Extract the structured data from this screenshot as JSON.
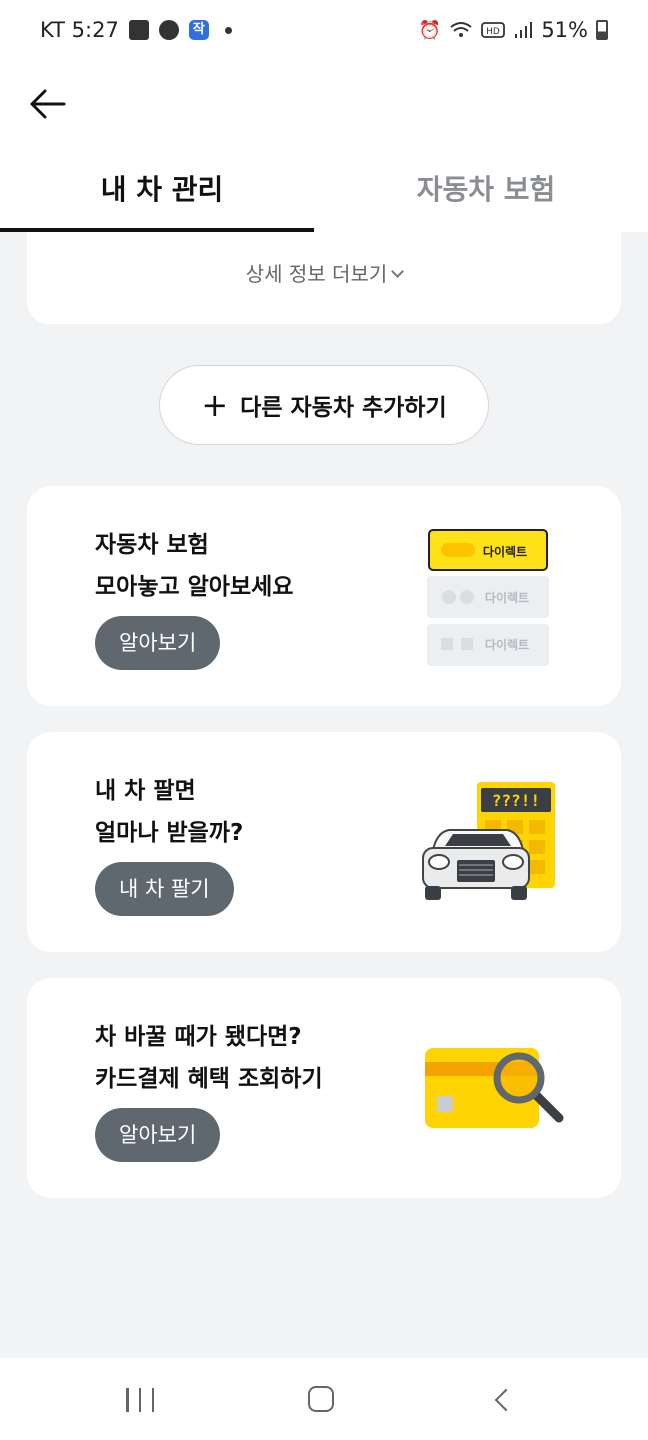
{
  "status_bar": {
    "carrier_time": "KT 5:27",
    "app_badge": "작",
    "battery": "51%"
  },
  "header": {
    "tabs": [
      {
        "label": "내 차 관리",
        "active": true
      },
      {
        "label": "자동차 보험",
        "active": false
      }
    ]
  },
  "detail": {
    "more_label": "상세 정보 더보기"
  },
  "add_car": {
    "label": "다른 자동차 추가하기"
  },
  "promos": [
    {
      "title_line1": "자동차 보험",
      "title_line2": "모아놓고 알아보세요",
      "button": "알아보기",
      "art_labels": [
        "다이렉트",
        "다이렉트",
        "다이렉트"
      ]
    },
    {
      "title_line1": "내 차 팔면",
      "title_line2": "얼마나 받을까?",
      "button": "내 차 팔기",
      "art_labels": [
        "???!!"
      ]
    },
    {
      "title_line1": "차 바꿀 때가 됐다면?",
      "title_line2": "카드결제 혜택 조회하기",
      "button": "알아보기"
    }
  ],
  "colors": {
    "background": "#f2f3f5",
    "button_dark": "#5f676f",
    "accent_yellow": "#ffd400"
  }
}
